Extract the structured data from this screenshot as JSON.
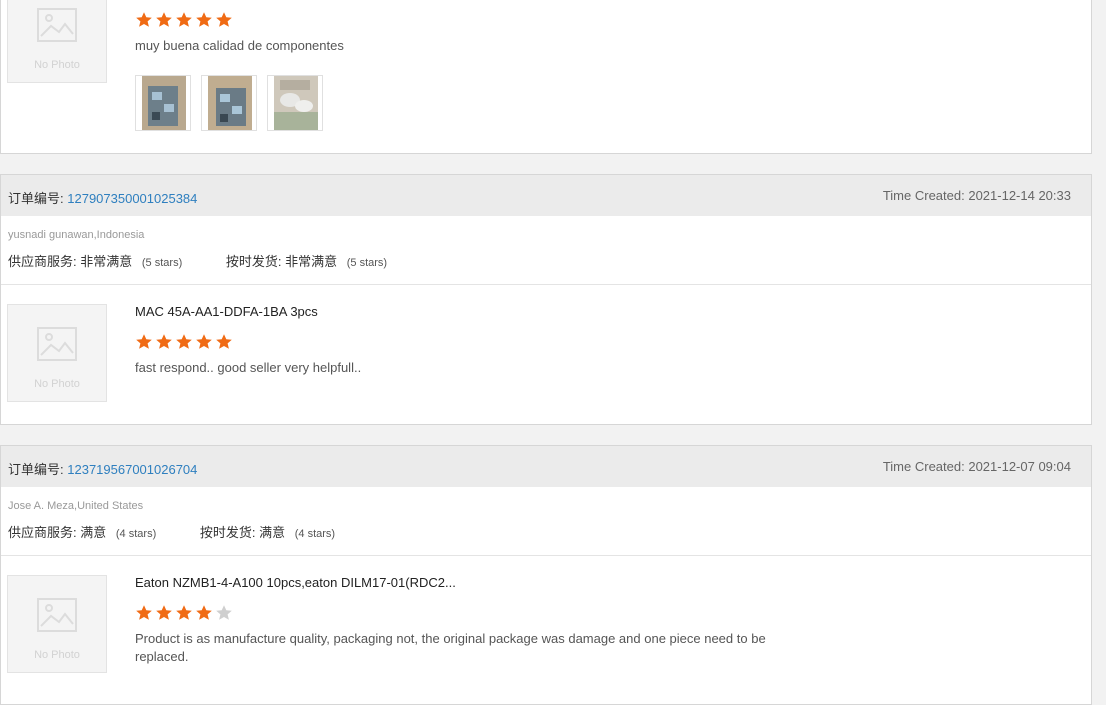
{
  "reviews": [
    {
      "product_title": "",
      "rating": 5,
      "text": "muy buena calidad de componentes",
      "photo_placeholder": "No Photo",
      "thumbnails": [
        "product-photo-1",
        "product-photo-2",
        "product-photo-3"
      ]
    }
  ],
  "orders": [
    {
      "order_label": "订单编号:",
      "order_id": "127907350001025384",
      "time_label": "Time Created:",
      "time_value": "2021-12-14 20:33",
      "buyer": "yusnadi gunawan,Indonesia",
      "service_label": "供应商服务:",
      "service_value": "非常满意",
      "service_stars": "(5 stars)",
      "delivery_label": "按时发货:",
      "delivery_value": "非常满意",
      "delivery_stars": "(5 stars)",
      "photo_placeholder": "No Photo",
      "product_title": "MAC 45A-AA1-DDFA-1BA 3pcs",
      "rating": 5,
      "review_text": "fast respond.. good seller very helpfull.."
    },
    {
      "order_label": "订单编号:",
      "order_id": "123719567001026704",
      "time_label": "Time Created:",
      "time_value": "2021-12-07 09:04",
      "buyer": "Jose A. Meza,United States",
      "service_label": "供应商服务:",
      "service_value": "满意",
      "service_stars": "(4 stars)",
      "delivery_label": "按时发货:",
      "delivery_value": "满意",
      "delivery_stars": "(4 stars)",
      "photo_placeholder": "No Photo",
      "product_title": "Eaton NZMB1-4-A100 10pcs,eaton DILM17-01(RDC2...",
      "rating": 4,
      "review_text": "Product is as manufacture quality, packaging not, the original package was damage and one piece need to be replaced."
    }
  ],
  "colors": {
    "star_active": "#f06b15",
    "star_inactive": "#cfcfcf",
    "link": "#2e7fbf"
  }
}
